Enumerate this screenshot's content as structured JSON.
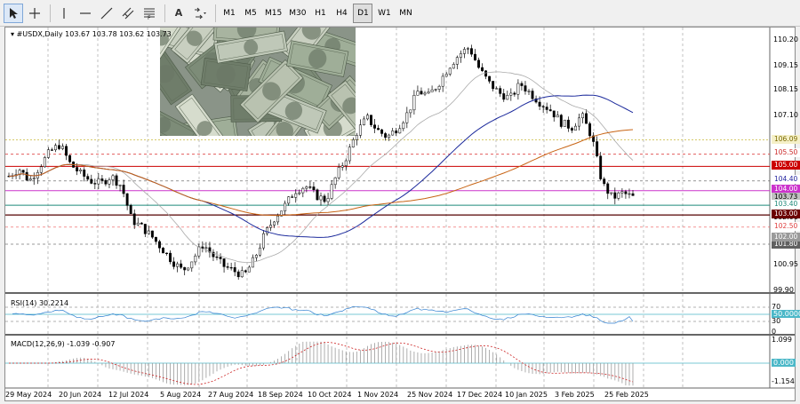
{
  "toolbar": {
    "tools": [
      {
        "name": "cursor-icon",
        "active": true
      },
      {
        "name": "crosshair-icon",
        "active": false
      },
      {
        "name": "vertical-line-icon",
        "active": false
      },
      {
        "name": "horizontal-line-icon",
        "active": false
      },
      {
        "name": "trendline-icon",
        "active": false
      },
      {
        "name": "equidistant-channel-icon",
        "active": false
      },
      {
        "name": "fibonacci-icon",
        "active": false
      },
      {
        "name": "text-tool-icon",
        "active": false
      },
      {
        "name": "arrow-shapes-icon",
        "active": false
      }
    ],
    "text_tool_label": "A",
    "timeframes": [
      "M1",
      "M5",
      "M15",
      "M30",
      "H1",
      "H4",
      "D1",
      "W1",
      "MN"
    ],
    "active_timeframe": "D1"
  },
  "chart": {
    "symbol_line": "#USDX,Daily  103.67 103.78 103.62 103.73",
    "price_axis": [
      "110.20",
      "109.15",
      "108.15",
      "107.10",
      "106.05",
      "105.00",
      "103.95",
      "102.90",
      "101.85",
      "100.95",
      "99.90"
    ],
    "price_tags": [
      {
        "text": "106.09",
        "bg": "#f5f0c8",
        "fg": "#7a6a00",
        "y": 126
      },
      {
        "text": "105.50",
        "bg": "#ffffff",
        "fg": "#cc2a2a",
        "y": 141
      },
      {
        "text": "105.00",
        "bg": "#cc0000",
        "fg": "#ffffff",
        "y": 155
      },
      {
        "text": "104.40",
        "bg": "#ffffff",
        "fg": "#1e1e9c",
        "y": 171
      },
      {
        "text": "104.00",
        "bg": "#cc33cc",
        "fg": "#ffffff",
        "y": 182
      },
      {
        "text": "103.73",
        "bg": "#c0c0c0",
        "fg": "#000000",
        "y": 191
      },
      {
        "text": "103.40",
        "bg": "#ffffff",
        "fg": "#1f8a7a",
        "y": 199
      },
      {
        "text": "103.00",
        "bg": "#6b0000",
        "fg": "#ffffff",
        "y": 210
      },
      {
        "text": "102.50",
        "bg": "#ffffff",
        "fg": "#e04040",
        "y": 224
      },
      {
        "text": "101.80",
        "bg": "#606060",
        "fg": "#ffffff",
        "y": 244
      },
      {
        "text": "102.00",
        "bg": "#9a9a9a",
        "fg": "#ffffff",
        "y": 236
      }
    ],
    "dates": [
      "29 May 2024",
      "20 Jun 2024",
      "12 Jul 2024",
      "5 Aug 2024",
      "27 Aug 2024",
      "18 Sep 2024",
      "10 Oct 2024",
      "1 Nov 2024",
      "25 Nov 2024",
      "17 Dec 2024",
      "10 Jan 2025",
      "3 Feb 2025",
      "25 Feb 2025"
    ]
  },
  "rsi": {
    "label": "RSI(14) 30.2214",
    "axis": [
      "70",
      "50.0000",
      "30",
      "0"
    ]
  },
  "macd": {
    "label": "MACD(12,26,9) -1.039 -0.907",
    "axis": [
      "1.099",
      "0.000",
      "-1.154"
    ]
  },
  "chart_data": {
    "type": "candlestick",
    "title": "#USDX,Daily",
    "ohlc_last": {
      "open": 103.67,
      "high": 103.78,
      "low": 103.62,
      "close": 103.73
    },
    "yrange": [
      99.9,
      110.2
    ],
    "x_ticks": [
      "29 May 2024",
      "20 Jun 2024",
      "12 Jul 2024",
      "5 Aug 2024",
      "27 Aug 2024",
      "18 Sep 2024",
      "10 Oct 2024",
      "1 Nov 2024",
      "25 Nov 2024",
      "17 Dec 2024",
      "10 Jan 2025",
      "3 Feb 2025",
      "25 Feb 2025"
    ],
    "closes_sampled": [
      104.6,
      104.9,
      104.4,
      105.0,
      105.6,
      105.9,
      105.1,
      104.7,
      104.4,
      104.3,
      104.6,
      104.2,
      102.8,
      102.5,
      102.1,
      101.6,
      101.1,
      100.7,
      101.2,
      101.8,
      101.3,
      100.9,
      100.7,
      100.5,
      101.2,
      102.2,
      102.9,
      103.4,
      104.0,
      104.2,
      103.8,
      103.6,
      104.6,
      105.4,
      106.4,
      107.0,
      106.5,
      106.2,
      106.6,
      107.2,
      108.1,
      107.9,
      108.4,
      109.1,
      109.6,
      109.9,
      109.0,
      108.4,
      108.0,
      107.8,
      108.4,
      108.0,
      107.6,
      107.3,
      106.8,
      106.6,
      107.1,
      106.2,
      104.3,
      103.7,
      103.9,
      103.73
    ],
    "horizontal_levels": [
      106.09,
      105.5,
      105.0,
      104.4,
      104.0,
      103.4,
      103.0,
      102.5,
      101.8
    ],
    "series": [
      {
        "name": "RSI(14)",
        "last": 30.2214
      },
      {
        "name": "MACD(12,26,9)",
        "last": -1.039,
        "signal": -0.907
      }
    ]
  }
}
